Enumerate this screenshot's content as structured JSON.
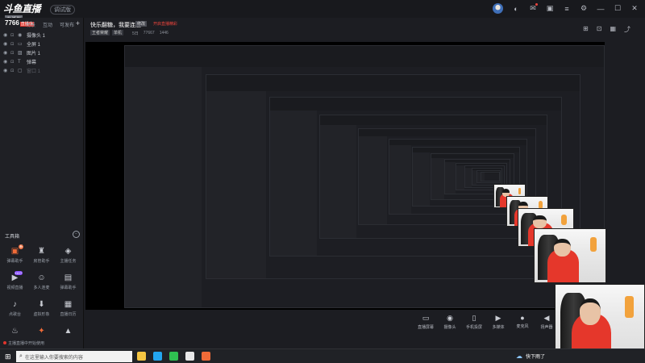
{
  "app": {
    "logo": "斗鱼直播伴侣",
    "logo_sub": "直播伴",
    "version": "调试版"
  },
  "titlebar_icons": [
    "avatar",
    "headset-icon",
    "mail-icon",
    "gift-icon",
    "menu-icon",
    "settings-icon",
    "minimize-icon",
    "maximize-icon",
    "close-icon"
  ],
  "left_panel": {
    "room_id": "7766",
    "room_tag": "直播中",
    "scene_tabs": [
      "场景",
      "互动",
      "可发布"
    ],
    "sources": [
      {
        "icon": "camera-icon",
        "label": "摄像头 1",
        "dim": false
      },
      {
        "icon": "monitor-icon",
        "label": "全屏 1",
        "dim": false
      },
      {
        "icon": "image-icon",
        "label": "图片 1",
        "dim": false
      },
      {
        "icon": "text-icon",
        "label": "弹幕",
        "dim": false
      },
      {
        "icon": "window-icon",
        "label": "窗口 1",
        "dim": true
      }
    ],
    "tools_title": "工具箱",
    "tools": [
      {
        "icon": "gift-icon",
        "label": "弹幕助手",
        "highlight": true,
        "badge": "新"
      },
      {
        "icon": "bell-icon",
        "label": "房管助手",
        "highlight": false,
        "badge": ""
      },
      {
        "icon": "bag-icon",
        "label": "主播任务",
        "highlight": false,
        "badge": ""
      },
      {
        "icon": "video-icon",
        "label": "视频直播",
        "highlight": false,
        "badge": "HOT"
      },
      {
        "icon": "users-icon",
        "label": "多人连麦",
        "highlight": false,
        "badge": ""
      },
      {
        "icon": "doc-icon",
        "label": "弹幕助手",
        "highlight": false,
        "badge": ""
      },
      {
        "icon": "music-icon",
        "label": "点歌台",
        "highlight": false,
        "badge": ""
      },
      {
        "icon": "download-icon",
        "label": "虚拟形象",
        "highlight": false,
        "badge": ""
      },
      {
        "icon": "calendar-icon",
        "label": "直播日历",
        "highlight": false,
        "badge": ""
      },
      {
        "icon": "cup-icon",
        "label": "",
        "highlight": false,
        "badge": ""
      },
      {
        "icon": "star-icon",
        "label": "",
        "highlight": true,
        "badge": ""
      },
      {
        "icon": "flame-icon",
        "label": "",
        "highlight": false,
        "badge": ""
      }
    ]
  },
  "header": {
    "title": "快乐翻糖，我要连胜",
    "edit_label": "修改",
    "red_note": "开启直播精彩",
    "category_tags": [
      "王者荣耀",
      "单机"
    ],
    "stats": [
      "5日",
      "77667",
      "1446"
    ]
  },
  "preview_icons": [
    "share-icon",
    "lock-icon",
    "grid-icon",
    "link-icon"
  ],
  "actions": [
    {
      "icon": "screen-icon",
      "label": "直播屏幕"
    },
    {
      "icon": "camera-icon",
      "label": "摄像头"
    },
    {
      "icon": "phone-icon",
      "label": "手机投屏"
    },
    {
      "icon": "media-icon",
      "label": "多媒体"
    },
    {
      "icon": "mic-icon",
      "label": "麦克风"
    },
    {
      "icon": "speaker-icon",
      "label": "扬声器"
    }
  ],
  "status_text": "主播直播中开始使用",
  "taskbar": {
    "search_placeholder": "在这里输入你要搜索的内容",
    "tray_text": "快下雨了",
    "app_colors": [
      "#f4c542",
      "#23a6f0",
      "#2fbf51",
      "#e8e8e8",
      "#f06b38"
    ]
  },
  "colors": {
    "accent": "#f06b38",
    "live_red": "#e0352d",
    "bg": "#1c1d22"
  }
}
